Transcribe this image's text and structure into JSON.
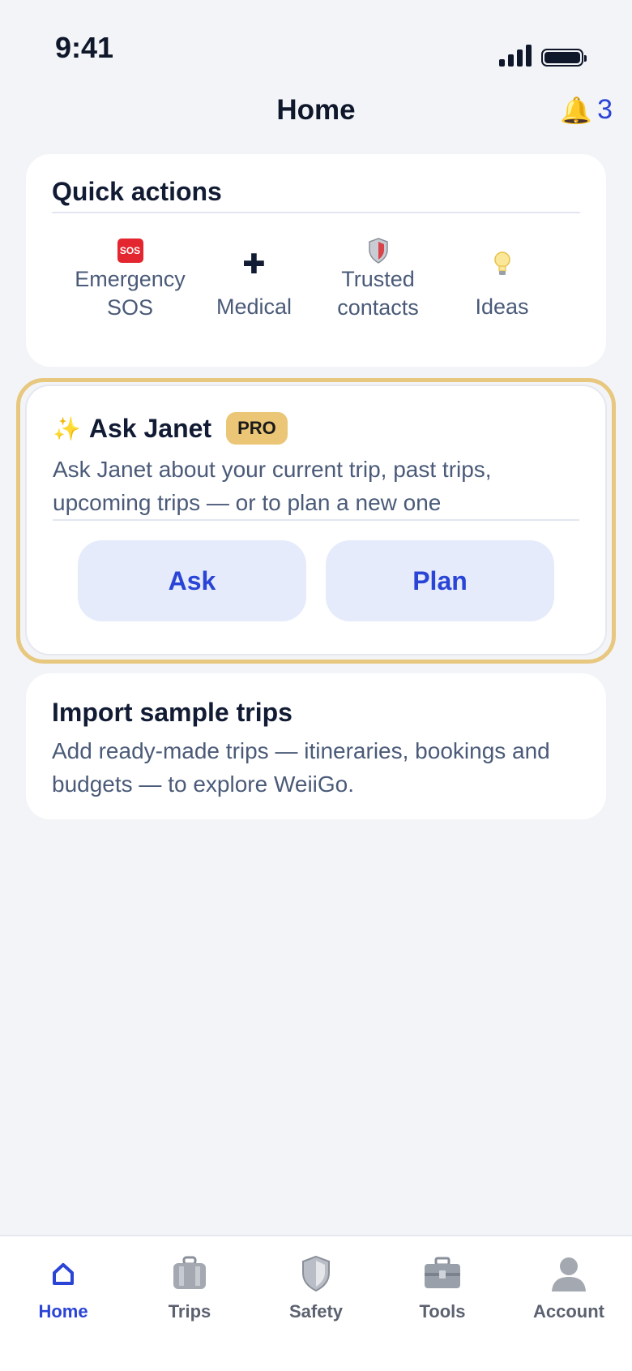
{
  "status_bar": {
    "time": "9:41"
  },
  "header": {
    "title": "Home",
    "notification_count": "3",
    "bell_icon": "bell-icon"
  },
  "quick_actions": {
    "title": "Quick actions",
    "items": [
      {
        "label": "Emergency\nSOS",
        "icon": "sos-icon",
        "icon_text": "SOS"
      },
      {
        "label": "Medical",
        "icon": "medical-cross-icon"
      },
      {
        "label": "Trusted\ncontacts",
        "icon": "shield-icon"
      },
      {
        "label": "Ideas",
        "icon": "lightbulb-icon"
      }
    ]
  },
  "ask_janet": {
    "title": "Ask Janet",
    "badge": "PRO",
    "description": "Ask Janet about your current trip, past trips, upcoming trips — or to plan a new one",
    "ask_label": "Ask",
    "plan_label": "Plan"
  },
  "import_trips": {
    "title": "Import sample trips",
    "description": "Add ready-made trips — itineraries, bookings and budgets — to explore WeiiGo."
  },
  "tabbar": {
    "active": "Home",
    "items": [
      {
        "label": "Home",
        "icon": "home-icon"
      },
      {
        "label": "Trips",
        "icon": "luggage-icon"
      },
      {
        "label": "Safety",
        "icon": "shield-icon"
      },
      {
        "label": "Tools",
        "icon": "toolbox-icon"
      },
      {
        "label": "Account",
        "icon": "person-icon"
      }
    ]
  },
  "colors": {
    "accent": "#2a44d6",
    "pro_gold": "#ebc676",
    "background": "#f3f4f8"
  }
}
